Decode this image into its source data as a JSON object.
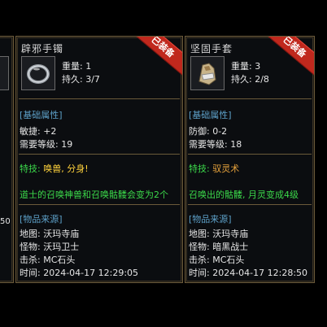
{
  "edge_panel": {
    "text": "50"
  },
  "left": {
    "title": "辟邪手镯",
    "equipped_badge": "已装备",
    "icon": "bracelet-icon",
    "weight": "重量: 1",
    "durability": "持久: 3/7",
    "base_section": "[基础属性]",
    "stat1": "敏捷: +2",
    "stat2": "需要等级: 19",
    "skill_label": "特技:",
    "skill_value": "唤兽, 分身!",
    "skill_desc": "道士的召唤神兽和召唤骷髅会变为2个",
    "source_section": "[物品来源]",
    "map": "地图: 沃玛寺庙",
    "monster": "怪物: 沃玛卫士",
    "kill": "击杀: MC石头",
    "time": "时间: 2024-04-17 12:29:05"
  },
  "right": {
    "title": "坚固手套",
    "equipped_badge": "已装备",
    "icon": "gauntlet-icon",
    "weight": "重量: 3",
    "durability": "持久: 2/8",
    "base_section": "[基础属性]",
    "stat1": "防御: 0-2",
    "stat2": "需要等级: 18",
    "skill_label": "特技:",
    "skill_value": "驭灵术",
    "skill_desc": "召唤出的骷髅, 月灵变成4级",
    "source_section": "[物品来源]",
    "map": "地图: 沃玛寺庙",
    "monster": "怪物: 暗黑战士",
    "kill": "击杀: MC石头",
    "time": "时间: 2024-04-17 12:28:50"
  },
  "colors": {
    "border": "#6b5a3a",
    "section": "#5da0c8",
    "skill": "#3bd84a",
    "skill_value_left": "#ffd23c",
    "skill_value_right": "#e6a23c",
    "badge": "#c0281d"
  }
}
